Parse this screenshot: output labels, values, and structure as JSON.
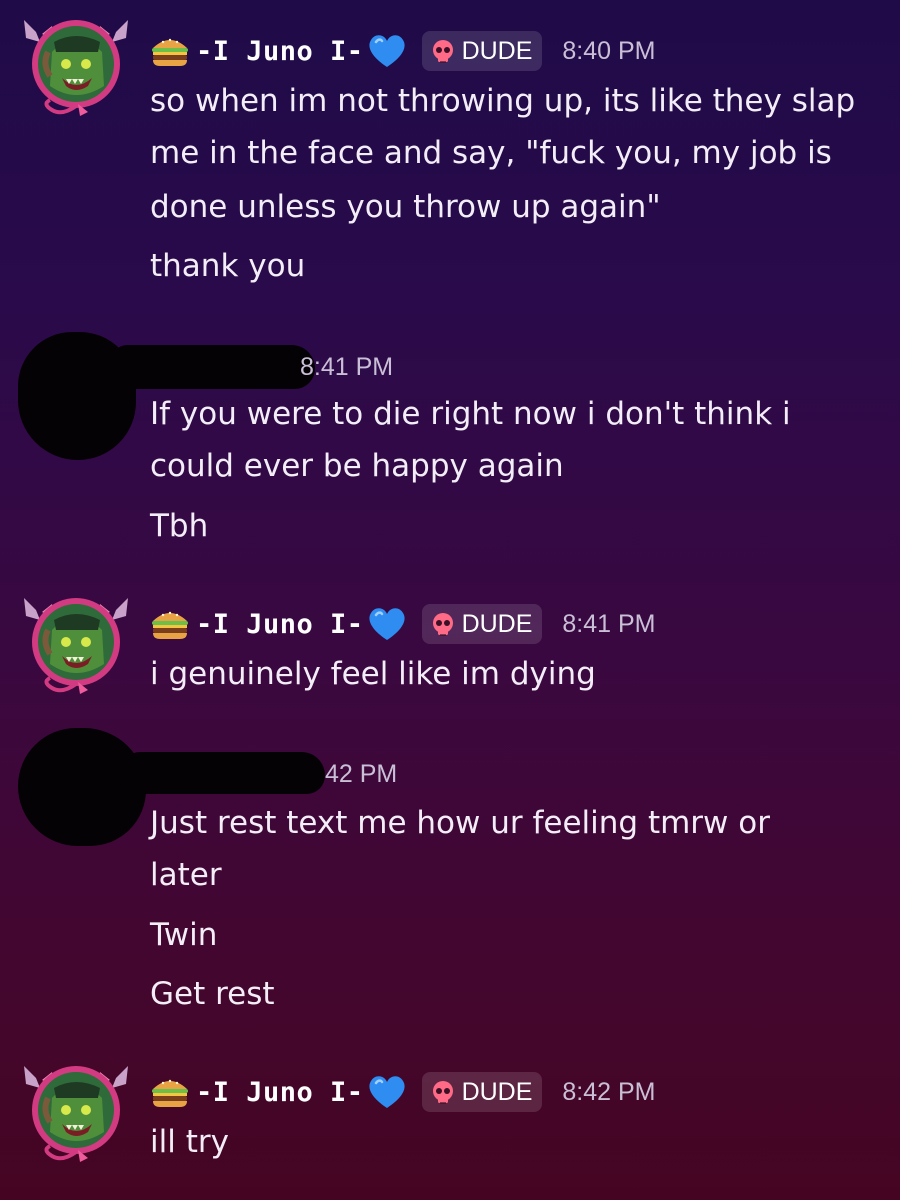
{
  "colors": {
    "background_top": "#1f0b48",
    "background_bottom": "#450522",
    "heart": "#2f8cf0",
    "tag_bg": "rgba(255,255,255,0.13)",
    "skull": "#ff6a86"
  },
  "messages": [
    {
      "author": "-I Juno I-",
      "author_emoji_prefix": "hamburger-icon",
      "author_emoji_suffix": "blue-heart-icon",
      "tag_icon": "skull-icon",
      "tag": "DUDE",
      "time": "8:40 PM",
      "lines": [
        "so when im not throwing up, its like they slap",
        "me in the face and say, \"fuck you, my job is",
        "done unless you throw up again\"",
        "thank you"
      ]
    },
    {
      "author_redacted": true,
      "time": "8:41 PM",
      "lines": [
        "If you were to die right now i don't think i",
        "could ever be happy again",
        "Tbh"
      ]
    },
    {
      "author": "-I Juno I-",
      "author_emoji_prefix": "hamburger-icon",
      "author_emoji_suffix": "blue-heart-icon",
      "tag_icon": "skull-icon",
      "tag": "DUDE",
      "time": "8:41 PM",
      "lines": [
        "i genuinely feel like im dying"
      ]
    },
    {
      "author_redacted": true,
      "time": "42 PM",
      "lines": [
        "Just rest text me how ur feeling tmrw or",
        "later",
        "Twin",
        "Get rest"
      ]
    },
    {
      "author": "-I Juno I-",
      "author_emoji_prefix": "hamburger-icon",
      "author_emoji_suffix": "blue-heart-icon",
      "tag_icon": "skull-icon",
      "tag": "DUDE",
      "time": "8:42 PM",
      "lines": [
        "ill try"
      ]
    }
  ]
}
